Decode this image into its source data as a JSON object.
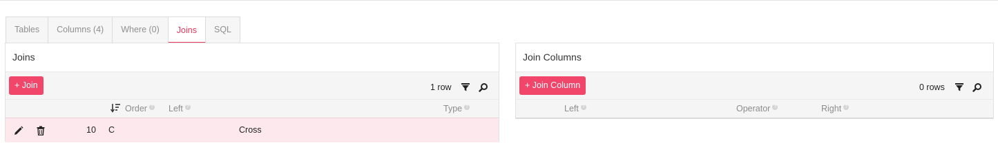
{
  "tabs": [
    {
      "label": "Tables"
    },
    {
      "label": "Columns (4)"
    },
    {
      "label": "Where (0)"
    },
    {
      "label": "Joins",
      "active": true
    },
    {
      "label": "SQL"
    }
  ],
  "joins_panel": {
    "title": "Joins",
    "add_button": "+ Join",
    "row_count": "1 row",
    "columns": {
      "order": "Order",
      "left": "Left",
      "type": "Type"
    },
    "row": {
      "order": "10",
      "left": "C",
      "type": "Cross"
    }
  },
  "join_columns_panel": {
    "title": "Join Columns",
    "add_button": "+ Join Column",
    "row_count": "0 rows",
    "columns": {
      "left": "Left",
      "operator": "Operator",
      "right": "Right"
    }
  },
  "colors": {
    "accent": "#e8385a",
    "button": "#f1456a",
    "selected_row": "#fde9ed"
  },
  "icons": [
    "filter-icon",
    "search-icon",
    "sort-descending-icon",
    "help-icon",
    "edit-pencil-icon",
    "trash-icon"
  ]
}
